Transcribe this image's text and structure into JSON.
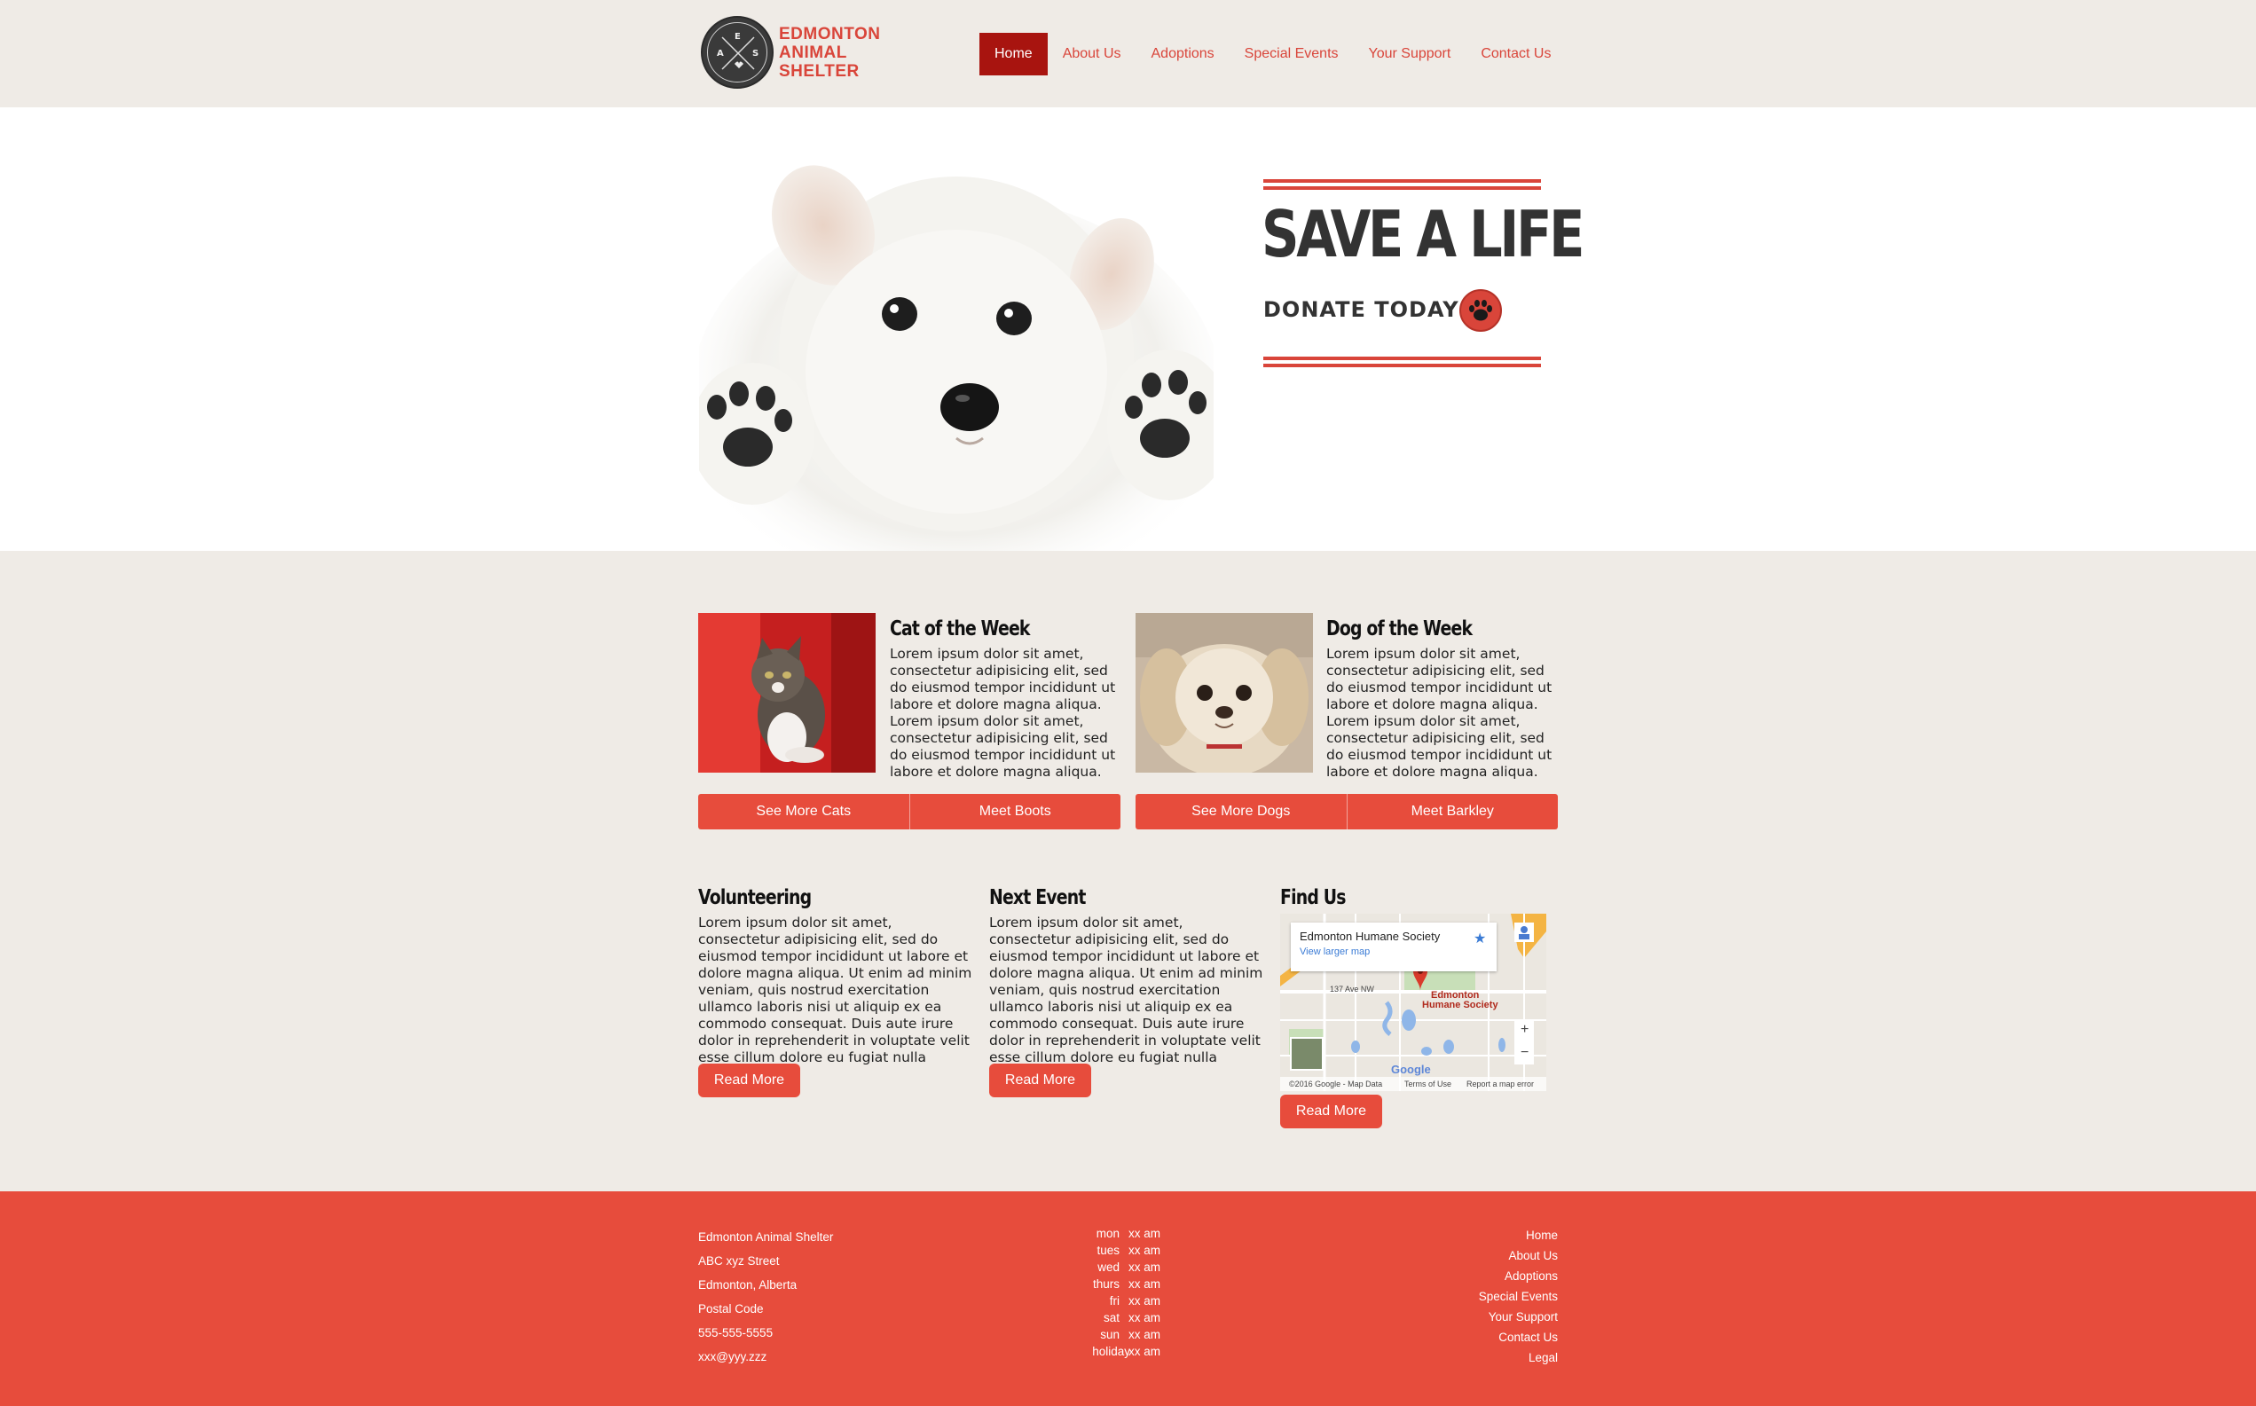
{
  "brand": {
    "logo_letters": [
      "A",
      "E",
      "S"
    ],
    "name_lines": [
      "EDMONTON",
      "ANIMAL",
      "SHELTER"
    ]
  },
  "nav": {
    "items": [
      "Home",
      "About Us",
      "Adoptions",
      "Special Events",
      "Your Support",
      "Contact Us"
    ],
    "active": "Home"
  },
  "hero": {
    "headline": "SAVE A LIFE",
    "cta": "DONATE TODAY"
  },
  "pets": {
    "cat": {
      "title": "Cat of the Week",
      "body": "Lorem ipsum dolor sit amet, consectetur adipisicing elit, sed do eiusmod tempor incididunt ut labore et dolore magna aliqua. Lorem ipsum dolor sit amet, consectetur adipisicing elit, sed do eiusmod tempor incididunt ut labore et dolore magna aliqua.",
      "button_more": "See More Cats",
      "button_meet": "Meet Boots"
    },
    "dog": {
      "title": "Dog of the Week",
      "body": "Lorem ipsum dolor sit amet, consectetur adipisicing elit, sed do eiusmod tempor incididunt ut labore et dolore magna aliqua. Lorem ipsum dolor sit amet, consectetur adipisicing elit, sed do eiusmod tempor incididunt ut labore et dolore magna aliqua.",
      "button_more": "See More Dogs",
      "button_meet": "Meet Barkley"
    }
  },
  "sections": {
    "volunteering": {
      "title": "Volunteering",
      "body": "Lorem ipsum dolor sit amet, consectetur adipisicing elit, sed do eiusmod tempor incididunt ut labore et dolore magna aliqua. Ut enim ad minim veniam, quis nostrud exercitation ullamco laboris nisi ut aliquip ex ea commodo consequat. Duis aute irure dolor in reprehenderit in voluptate velit esse cillum dolore eu fugiat nulla pariatur.",
      "button": "Read More"
    },
    "next_event": {
      "title": "Next Event",
      "body": "Lorem ipsum dolor sit amet, consectetur adipisicing elit, sed do eiusmod tempor incididunt ut labore et dolore magna aliqua. Ut enim ad minim veniam, quis nostrud exercitation ullamco laboris nisi ut aliquip ex ea commodo consequat. Duis aute irure dolor in reprehenderit in voluptate velit esse cillum dolore eu fugiat nulla pariatur.",
      "button": "Read More"
    },
    "find_us": {
      "title": "Find Us",
      "button": "Read More",
      "map": {
        "place": "Edmonton Humane Society",
        "link": "View larger map",
        "pin_label_1": "Edmonton",
        "pin_label_2": "Humane Society",
        "street": "137 Ave NW",
        "copyright": "©2016 Google - Map Data",
        "terms": "Terms of Use",
        "report": "Report a map error",
        "zoom_in": "+",
        "zoom_out": "−",
        "google": "Google"
      }
    }
  },
  "footer": {
    "address": [
      "Edmonton Animal Shelter",
      "ABC xyz Street",
      "Edmonton, Alberta",
      "Postal Code",
      "555-555-5555",
      "xxx@yyy.zzz"
    ],
    "hours": [
      {
        "day": "mon",
        "time": "xx am"
      },
      {
        "day": "tues",
        "time": "xx am"
      },
      {
        "day": "wed",
        "time": "xx am"
      },
      {
        "day": "thurs",
        "time": "xx am"
      },
      {
        "day": "fri",
        "time": "xx am"
      },
      {
        "day": "sat",
        "time": "xx am"
      },
      {
        "day": "sun",
        "time": "xx am"
      },
      {
        "day": "holiday",
        "time": "xx am"
      }
    ],
    "links": [
      "Home",
      "About Us",
      "Adoptions",
      "Special Events",
      "Your Support",
      "Contact Us",
      "Legal"
    ]
  },
  "colors": {
    "accent": "#e74c3c",
    "nav_active": "#a8140f",
    "background": "#efebe6",
    "text_dark": "#333333"
  }
}
